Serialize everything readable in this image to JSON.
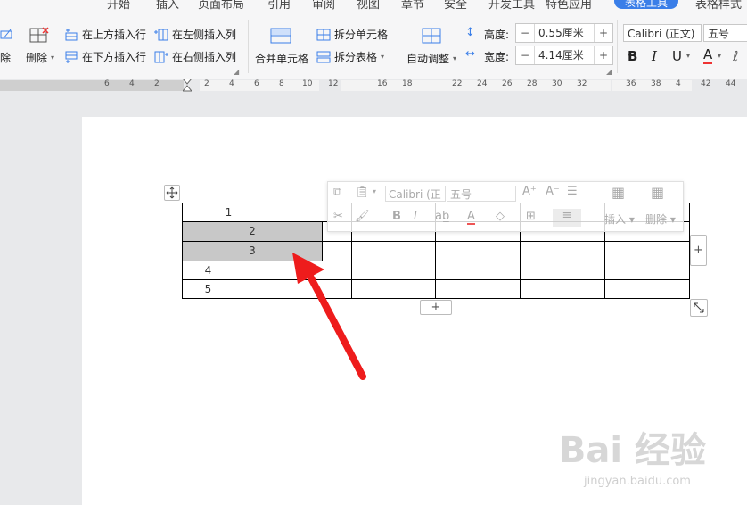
{
  "menubar": {
    "items": [
      "开始",
      "插入",
      "页面布局",
      "引用",
      "审阅",
      "视图",
      "章节",
      "安全",
      "开发工具",
      "特色应用"
    ],
    "active_tab": "表格工具",
    "next_tab": "表格样式"
  },
  "ribbon": {
    "delete_left": "除",
    "delete": "删除",
    "insert_above": "在上方插入行",
    "insert_below": "在下方插入行",
    "insert_left": "在左侧插入列",
    "insert_right": "在右侧插入列",
    "merge_cells": "合并单元格",
    "split_cells": "拆分单元格",
    "split_table": "拆分表格",
    "auto_fit": "自动调整",
    "height_label": "高度:",
    "height_value": "0.55厘米",
    "width_label": "宽度:",
    "width_value": "4.14厘米",
    "font_name": "Calibri (正文)",
    "font_size": "五号",
    "bold": "B",
    "italic": "I",
    "underline": "U",
    "font_color": "A",
    "clear": "ℓ"
  },
  "ruler": {
    "numbers": [
      "6",
      "4",
      "2",
      "2",
      "4",
      "6",
      "8",
      "10",
      "12",
      "16",
      "18",
      "22",
      "24",
      "26",
      "28",
      "30",
      "32",
      "36",
      "38",
      "4",
      "42",
      "44"
    ]
  },
  "float_toolbar": {
    "font_name": "Calibri (正",
    "font_size": "五号",
    "insert": "插入",
    "delete": "删除"
  },
  "table": {
    "cells": [
      "1",
      "2",
      "3",
      "4",
      "5"
    ]
  },
  "watermark": {
    "brand": "Bai 经验",
    "url": "jingyan.baidu.com"
  },
  "colors": {
    "accent": "#3a7ee8",
    "arrow": "#ee1c1c",
    "selected_cell": "#c8c8c8"
  }
}
